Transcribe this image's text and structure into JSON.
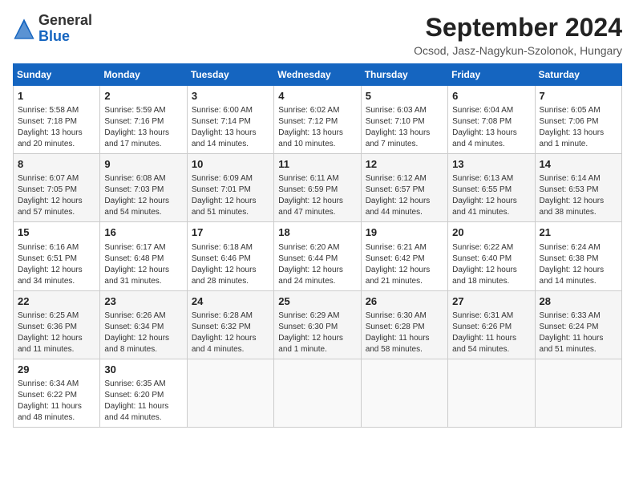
{
  "header": {
    "logo_general": "General",
    "logo_blue": "Blue",
    "month_title": "September 2024",
    "subtitle": "Ocsod, Jasz-Nagykun-Szolonok, Hungary"
  },
  "calendar": {
    "headers": [
      "Sunday",
      "Monday",
      "Tuesday",
      "Wednesday",
      "Thursday",
      "Friday",
      "Saturday"
    ],
    "weeks": [
      [
        {
          "day": "1",
          "info": "Sunrise: 5:58 AM\nSunset: 7:18 PM\nDaylight: 13 hours and 20 minutes."
        },
        {
          "day": "2",
          "info": "Sunrise: 5:59 AM\nSunset: 7:16 PM\nDaylight: 13 hours and 17 minutes."
        },
        {
          "day": "3",
          "info": "Sunrise: 6:00 AM\nSunset: 7:14 PM\nDaylight: 13 hours and 14 minutes."
        },
        {
          "day": "4",
          "info": "Sunrise: 6:02 AM\nSunset: 7:12 PM\nDaylight: 13 hours and 10 minutes."
        },
        {
          "day": "5",
          "info": "Sunrise: 6:03 AM\nSunset: 7:10 PM\nDaylight: 13 hours and 7 minutes."
        },
        {
          "day": "6",
          "info": "Sunrise: 6:04 AM\nSunset: 7:08 PM\nDaylight: 13 hours and 4 minutes."
        },
        {
          "day": "7",
          "info": "Sunrise: 6:05 AM\nSunset: 7:06 PM\nDaylight: 13 hours and 1 minute."
        }
      ],
      [
        {
          "day": "8",
          "info": "Sunrise: 6:07 AM\nSunset: 7:05 PM\nDaylight: 12 hours and 57 minutes."
        },
        {
          "day": "9",
          "info": "Sunrise: 6:08 AM\nSunset: 7:03 PM\nDaylight: 12 hours and 54 minutes."
        },
        {
          "day": "10",
          "info": "Sunrise: 6:09 AM\nSunset: 7:01 PM\nDaylight: 12 hours and 51 minutes."
        },
        {
          "day": "11",
          "info": "Sunrise: 6:11 AM\nSunset: 6:59 PM\nDaylight: 12 hours and 47 minutes."
        },
        {
          "day": "12",
          "info": "Sunrise: 6:12 AM\nSunset: 6:57 PM\nDaylight: 12 hours and 44 minutes."
        },
        {
          "day": "13",
          "info": "Sunrise: 6:13 AM\nSunset: 6:55 PM\nDaylight: 12 hours and 41 minutes."
        },
        {
          "day": "14",
          "info": "Sunrise: 6:14 AM\nSunset: 6:53 PM\nDaylight: 12 hours and 38 minutes."
        }
      ],
      [
        {
          "day": "15",
          "info": "Sunrise: 6:16 AM\nSunset: 6:51 PM\nDaylight: 12 hours and 34 minutes."
        },
        {
          "day": "16",
          "info": "Sunrise: 6:17 AM\nSunset: 6:48 PM\nDaylight: 12 hours and 31 minutes."
        },
        {
          "day": "17",
          "info": "Sunrise: 6:18 AM\nSunset: 6:46 PM\nDaylight: 12 hours and 28 minutes."
        },
        {
          "day": "18",
          "info": "Sunrise: 6:20 AM\nSunset: 6:44 PM\nDaylight: 12 hours and 24 minutes."
        },
        {
          "day": "19",
          "info": "Sunrise: 6:21 AM\nSunset: 6:42 PM\nDaylight: 12 hours and 21 minutes."
        },
        {
          "day": "20",
          "info": "Sunrise: 6:22 AM\nSunset: 6:40 PM\nDaylight: 12 hours and 18 minutes."
        },
        {
          "day": "21",
          "info": "Sunrise: 6:24 AM\nSunset: 6:38 PM\nDaylight: 12 hours and 14 minutes."
        }
      ],
      [
        {
          "day": "22",
          "info": "Sunrise: 6:25 AM\nSunset: 6:36 PM\nDaylight: 12 hours and 11 minutes."
        },
        {
          "day": "23",
          "info": "Sunrise: 6:26 AM\nSunset: 6:34 PM\nDaylight: 12 hours and 8 minutes."
        },
        {
          "day": "24",
          "info": "Sunrise: 6:28 AM\nSunset: 6:32 PM\nDaylight: 12 hours and 4 minutes."
        },
        {
          "day": "25",
          "info": "Sunrise: 6:29 AM\nSunset: 6:30 PM\nDaylight: 12 hours and 1 minute."
        },
        {
          "day": "26",
          "info": "Sunrise: 6:30 AM\nSunset: 6:28 PM\nDaylight: 11 hours and 58 minutes."
        },
        {
          "day": "27",
          "info": "Sunrise: 6:31 AM\nSunset: 6:26 PM\nDaylight: 11 hours and 54 minutes."
        },
        {
          "day": "28",
          "info": "Sunrise: 6:33 AM\nSunset: 6:24 PM\nDaylight: 11 hours and 51 minutes."
        }
      ],
      [
        {
          "day": "29",
          "info": "Sunrise: 6:34 AM\nSunset: 6:22 PM\nDaylight: 11 hours and 48 minutes."
        },
        {
          "day": "30",
          "info": "Sunrise: 6:35 AM\nSunset: 6:20 PM\nDaylight: 11 hours and 44 minutes."
        },
        {
          "day": "",
          "info": ""
        },
        {
          "day": "",
          "info": ""
        },
        {
          "day": "",
          "info": ""
        },
        {
          "day": "",
          "info": ""
        },
        {
          "day": "",
          "info": ""
        }
      ]
    ]
  }
}
